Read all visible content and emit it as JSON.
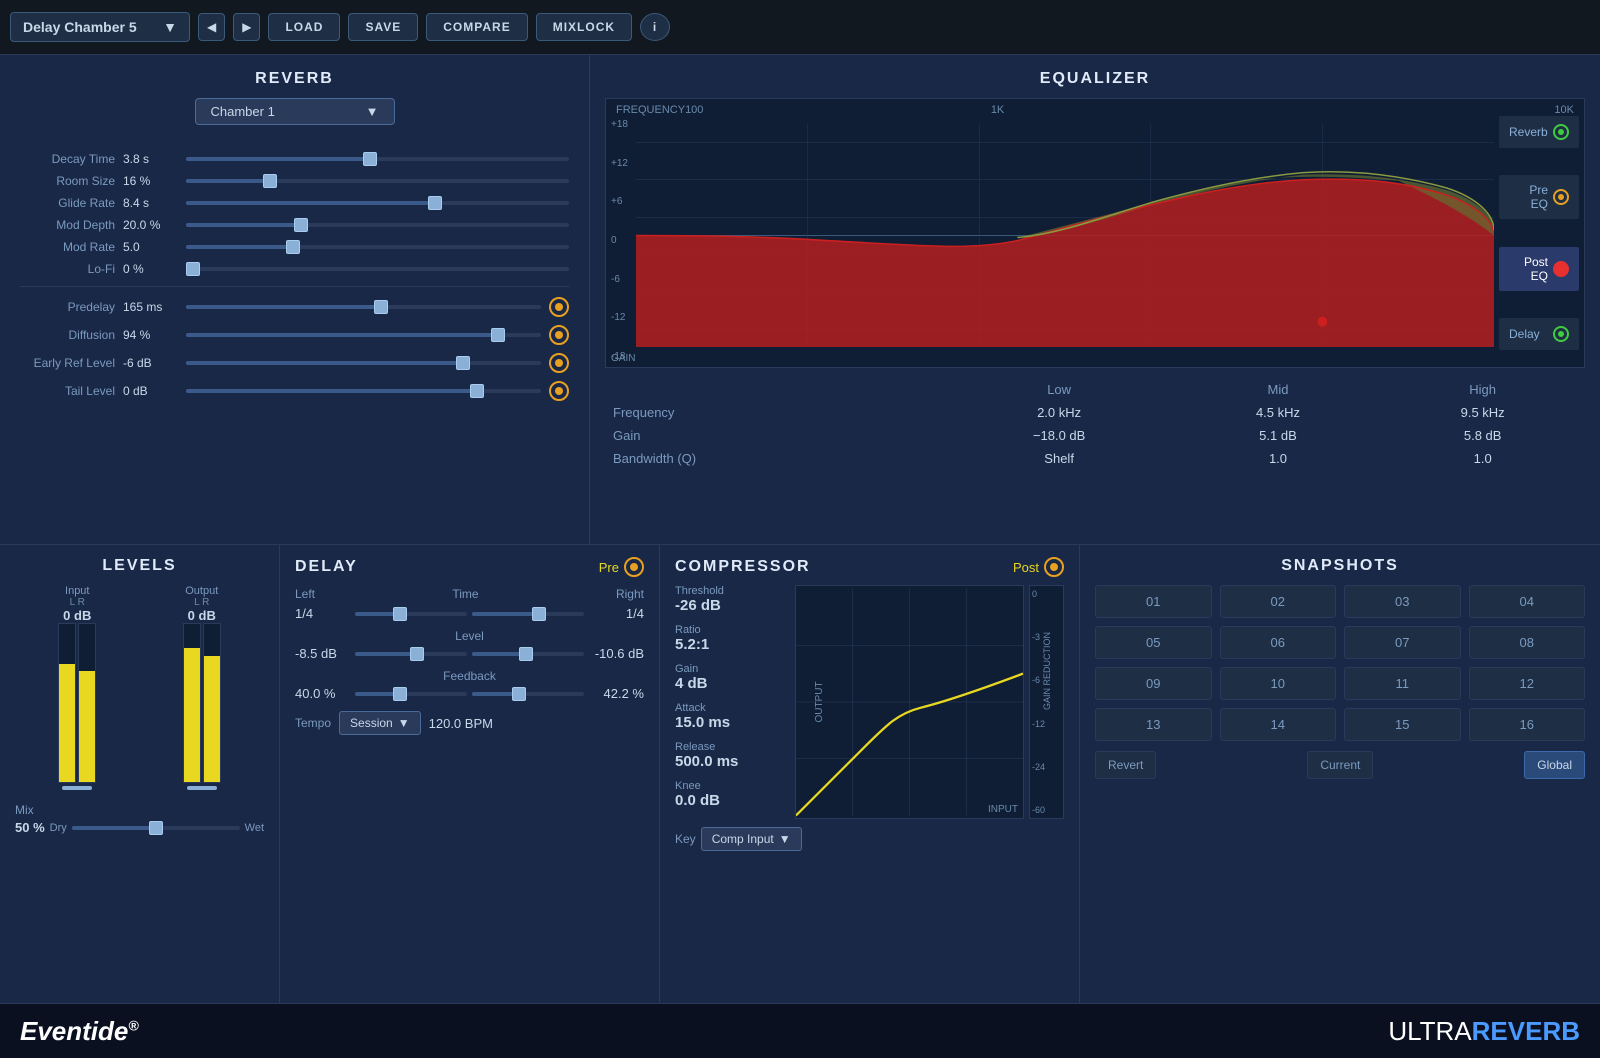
{
  "topbar": {
    "preset_name": "Delay Chamber 5",
    "load_label": "LOAD",
    "save_label": "SAVE",
    "compare_label": "COMPARE",
    "mixlock_label": "MIXLOCK",
    "info_label": "i"
  },
  "reverb": {
    "title": "REVERB",
    "type": "Chamber 1",
    "params": [
      {
        "label": "Decay Time",
        "value": "3.8 s",
        "pct": 48
      },
      {
        "label": "Room Size",
        "value": "16 %",
        "pct": 22
      },
      {
        "label": "Glide Rate",
        "value": "8.4 s",
        "pct": 65
      },
      {
        "label": "Mod Depth",
        "value": "20.0 %",
        "pct": 30
      },
      {
        "label": "Mod Rate",
        "value": "5.0",
        "pct": 28
      },
      {
        "label": "Lo-Fi",
        "value": "0 %",
        "pct": 0
      }
    ],
    "predelay": {
      "label": "Predelay",
      "value": "165 ms",
      "pct": 55
    },
    "diffusion": {
      "label": "Diffusion",
      "value": "94 %",
      "pct": 88
    },
    "earlyref": {
      "label": "Early Ref Level",
      "value": "-6 dB",
      "pct": 78
    },
    "taillevel": {
      "label": "Tail Level",
      "value": "0 dB",
      "pct": 82
    }
  },
  "equalizer": {
    "title": "EQUALIZER",
    "freq_labels": [
      "FREQUENCY",
      "100",
      "1K",
      "10K"
    ],
    "gain_labels": [
      "+18",
      "+12",
      "+6",
      "0",
      "-6",
      "-12",
      "-18"
    ],
    "gain_axis_label": "GAIN",
    "tabs": [
      {
        "label": "Reverb",
        "active": false,
        "power_color": "#40cc40"
      },
      {
        "label": "Pre EQ",
        "active": false,
        "power_color": "#e8a020"
      },
      {
        "label": "Post EQ",
        "active": true,
        "power_color": "#e83030"
      },
      {
        "label": "Delay",
        "active": false,
        "power_color": "#40cc40"
      }
    ],
    "columns": [
      "",
      "Low",
      "Mid",
      "High"
    ],
    "rows": [
      {
        "label": "Frequency",
        "low": "2.0 kHz",
        "mid": "4.5 kHz",
        "high": "9.5 kHz"
      },
      {
        "label": "Gain",
        "low": "-18.0 dB",
        "mid": "5.1 dB",
        "high": "5.8 dB"
      },
      {
        "label": "Bandwidth (Q)",
        "low": "Shelf",
        "mid": "1.0",
        "high": "1.0"
      }
    ]
  },
  "levels": {
    "title": "LEVELS",
    "input_label": "Input",
    "input_value": "0 dB",
    "output_label": "Output",
    "output_value": "0 dB",
    "lr_label": "L R",
    "mix_label": "Mix",
    "mix_value": "50 %",
    "dry_label": "Dry",
    "wet_label": "Wet",
    "input_l_fill": 75,
    "input_r_fill": 70,
    "output_l_fill": 85,
    "output_r_fill": 80
  },
  "delay": {
    "title": "DELAY",
    "pre_label": "Pre",
    "left_label": "Left",
    "right_label": "Right",
    "time_label": "Time",
    "left_time": "1/4",
    "right_time": "1/4",
    "level_label": "Level",
    "left_level": "-8.5 dB",
    "right_level": "-10.6 dB",
    "feedback_label": "Feedback",
    "left_feedback": "40.0 %",
    "right_feedback": "42.2 %",
    "tempo_label": "Tempo",
    "tempo_value": "Session",
    "bpm_value": "120.0 BPM"
  },
  "compressor": {
    "title": "COMPRESSOR",
    "post_label": "Post",
    "threshold_label": "Threshold",
    "threshold_value": "-26 dB",
    "ratio_label": "Ratio",
    "ratio_value": "5.2:1",
    "gain_label": "Gain",
    "gain_value": "4 dB",
    "attack_label": "Attack",
    "attack_value": "15.0 ms",
    "release_label": "Release",
    "release_value": "500.0 ms",
    "knee_label": "Knee",
    "knee_value": "0.0 dB",
    "key_label": "Key",
    "key_value": "Comp Input",
    "gain_reduction_label": "GAIN REDUCTION",
    "output_label": "OUTPUT",
    "input_label": "INPUT",
    "gr_labels": [
      "0",
      "-3",
      "-6",
      "-12",
      "-24",
      "-60"
    ]
  },
  "snapshots": {
    "title": "SNAPSHOTS",
    "items": [
      "01",
      "02",
      "03",
      "04",
      "05",
      "06",
      "07",
      "08",
      "09",
      "10",
      "11",
      "12",
      "13",
      "14",
      "15",
      "16"
    ],
    "revert_label": "Revert",
    "current_label": "Current",
    "global_label": "Global"
  },
  "footer": {
    "brand_left": "Eventide",
    "brand_right_ultra": "ULTRA",
    "brand_right_reverb": "REVERB"
  }
}
